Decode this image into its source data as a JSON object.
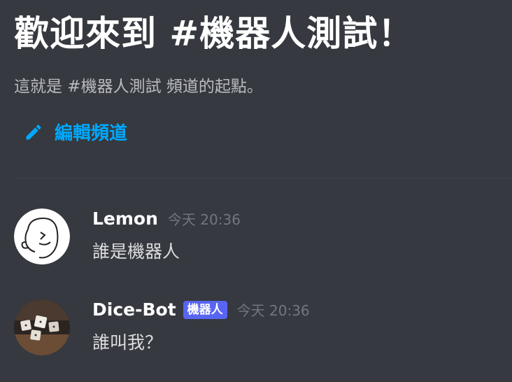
{
  "welcome": {
    "title": "歡迎來到 #機器人測試！",
    "subtitle": "這就是 #機器人測試 頻道的起點。",
    "edit_label": "編輯頻道"
  },
  "messages": [
    {
      "username": "Lemon",
      "timestamp": "今天 20:36",
      "content": "誰是機器人",
      "is_bot": false
    },
    {
      "username": "Dice-Bot",
      "badge": "機器人",
      "timestamp": "今天 20:36",
      "content": "誰叫我？",
      "is_bot": true
    }
  ],
  "colors": {
    "background": "#36393f",
    "link": "#00a8fc",
    "bot_badge": "#5865f2",
    "timestamp": "#72767d"
  },
  "icons": {
    "edit": "pencil-icon"
  }
}
